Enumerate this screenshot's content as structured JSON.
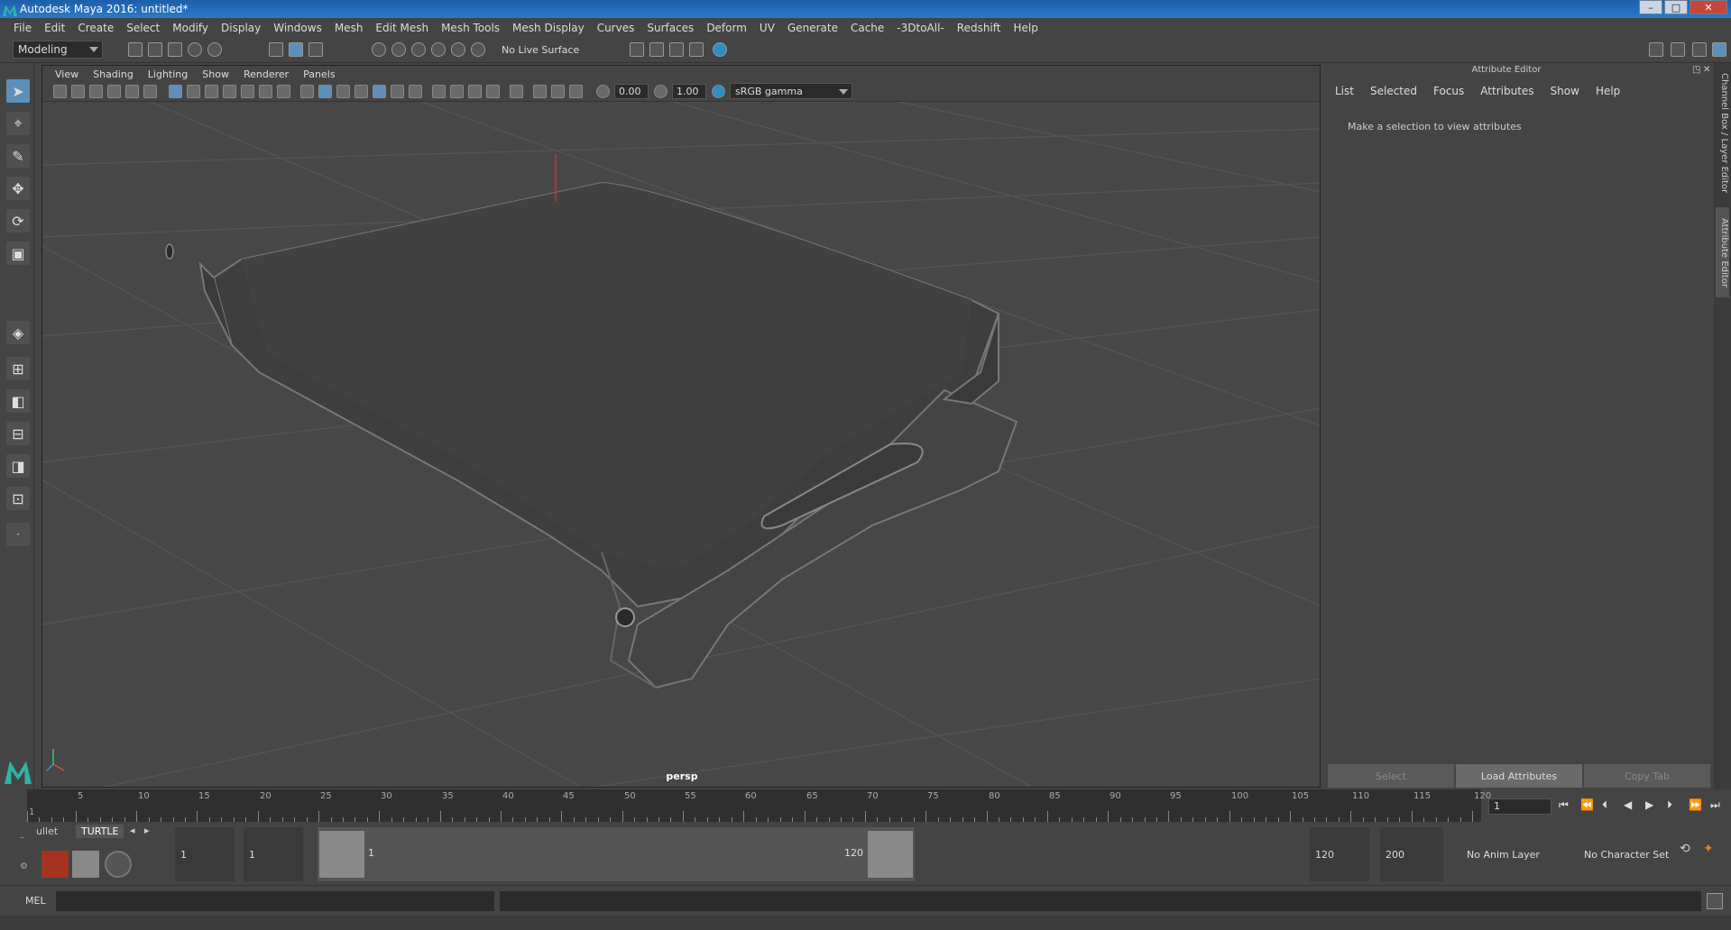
{
  "window": {
    "title": "Autodesk Maya 2016: untitled*"
  },
  "menubar": [
    "File",
    "Edit",
    "Create",
    "Select",
    "Modify",
    "Display",
    "Windows",
    "Mesh",
    "Edit Mesh",
    "Mesh Tools",
    "Mesh Display",
    "Curves",
    "Surfaces",
    "Deform",
    "UV",
    "Generate",
    "Cache",
    "-3DtoAll-",
    "Redshift",
    "Help"
  ],
  "shelf": {
    "mode": "Modeling",
    "live_surface": "No Live Surface"
  },
  "viewport": {
    "menu": [
      "View",
      "Shading",
      "Lighting",
      "Show",
      "Renderer",
      "Panels"
    ],
    "exposure": "0.00",
    "gamma": "1.00",
    "color_space": "sRGB gamma",
    "camera": "persp"
  },
  "attribute_editor": {
    "title": "Attribute Editor",
    "tabs": [
      "List",
      "Selected",
      "Focus",
      "Attributes",
      "Show",
      "Help"
    ],
    "message": "Make a selection to view attributes",
    "buttons": {
      "select": "Select",
      "load": "Load Attributes",
      "copy": "Copy Tab"
    }
  },
  "side_tabs": {
    "channel_box": "Channel Box / Layer Editor",
    "attribute_editor": "Attribute Editor"
  },
  "timeline": {
    "ticks": [
      "1",
      "5",
      "10",
      "15",
      "20",
      "25",
      "30",
      "35",
      "40",
      "45",
      "50",
      "55",
      "60",
      "65",
      "70",
      "75",
      "80",
      "85",
      "90",
      "95",
      "100",
      "105",
      "110",
      "115",
      "120"
    ],
    "current_frame": "1"
  },
  "range": {
    "start": "1",
    "playback_start": "1",
    "slider_start": "1",
    "slider_end": "120",
    "playback_end": "120",
    "end": "200",
    "anim_layer": "No Anim Layer",
    "character_set": "No Character Set"
  },
  "shelf_tabs": {
    "bullet": "ullet",
    "turtle": "TURTLE"
  },
  "command": {
    "label": "MEL"
  }
}
